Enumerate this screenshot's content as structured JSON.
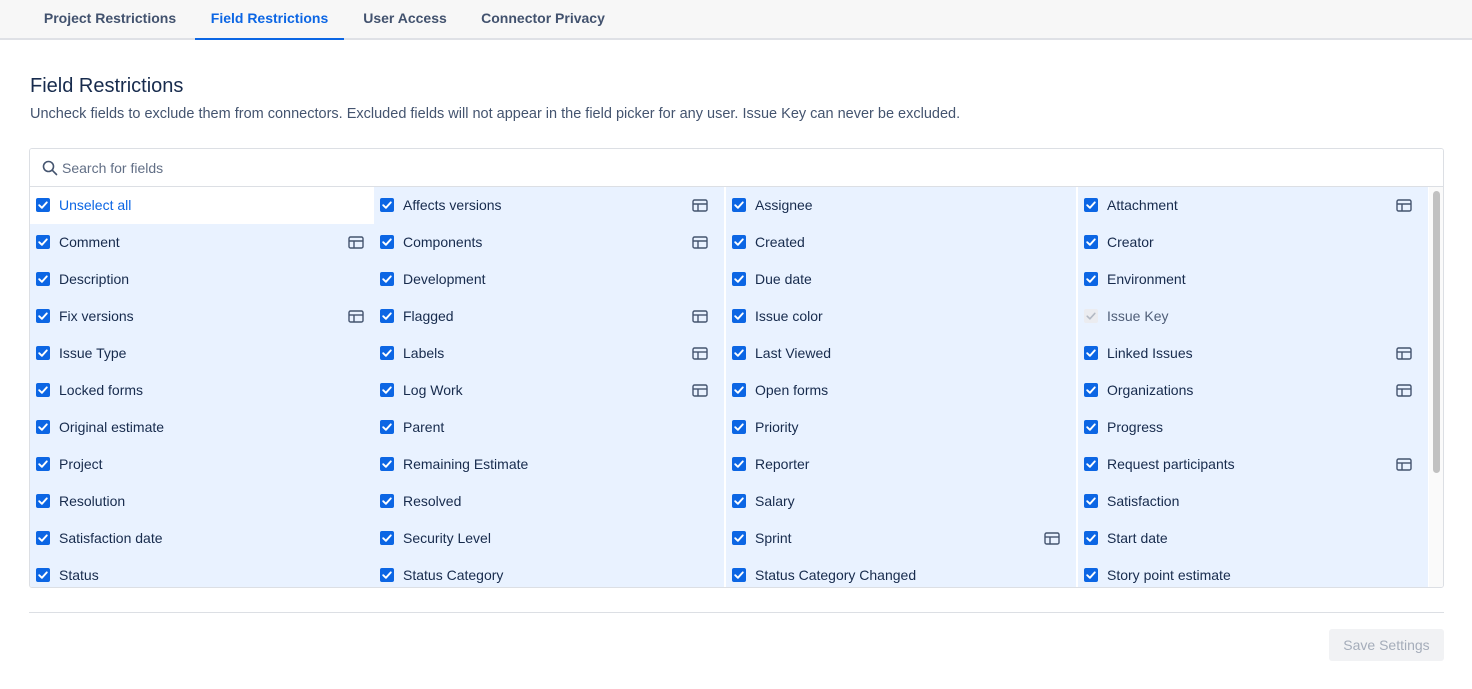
{
  "tabs": [
    {
      "label": "Project Restrictions",
      "active": false
    },
    {
      "label": "Field Restrictions",
      "active": true
    },
    {
      "label": "User Access",
      "active": false
    },
    {
      "label": "Connector Privacy",
      "active": false
    }
  ],
  "heading": "Field Restrictions",
  "description": "Uncheck fields to exclude them from connectors. Excluded fields will not appear in the field picker for any user. Issue Key can never be excluded.",
  "search": {
    "placeholder": "Search for fields",
    "value": ""
  },
  "fields": [
    {
      "label": "Unselect all",
      "checked": true,
      "kind": "toggle-all",
      "table_icon": false
    },
    {
      "label": "Affects versions",
      "checked": true,
      "table_icon": true
    },
    {
      "label": "Assignee",
      "checked": true,
      "table_icon": false
    },
    {
      "label": "Attachment",
      "checked": true,
      "table_icon": true
    },
    {
      "label": "Comment",
      "checked": true,
      "table_icon": true
    },
    {
      "label": "Components",
      "checked": true,
      "table_icon": true
    },
    {
      "label": "Created",
      "checked": true,
      "table_icon": false
    },
    {
      "label": "Creator",
      "checked": true,
      "table_icon": false
    },
    {
      "label": "Description",
      "checked": true,
      "table_icon": false
    },
    {
      "label": "Development",
      "checked": true,
      "table_icon": false
    },
    {
      "label": "Due date",
      "checked": true,
      "table_icon": false
    },
    {
      "label": "Environment",
      "checked": true,
      "table_icon": false
    },
    {
      "label": "Fix versions",
      "checked": true,
      "table_icon": true
    },
    {
      "label": "Flagged",
      "checked": true,
      "table_icon": true
    },
    {
      "label": "Issue color",
      "checked": true,
      "table_icon": false
    },
    {
      "label": "Issue Key",
      "checked": true,
      "disabled": true,
      "table_icon": false
    },
    {
      "label": "Issue Type",
      "checked": true,
      "table_icon": false
    },
    {
      "label": "Labels",
      "checked": true,
      "table_icon": true
    },
    {
      "label": "Last Viewed",
      "checked": true,
      "table_icon": false
    },
    {
      "label": "Linked Issues",
      "checked": true,
      "table_icon": true
    },
    {
      "label": "Locked forms",
      "checked": true,
      "table_icon": false
    },
    {
      "label": "Log Work",
      "checked": true,
      "table_icon": true
    },
    {
      "label": "Open forms",
      "checked": true,
      "table_icon": false
    },
    {
      "label": "Organizations",
      "checked": true,
      "table_icon": true
    },
    {
      "label": "Original estimate",
      "checked": true,
      "table_icon": false
    },
    {
      "label": "Parent",
      "checked": true,
      "table_icon": false
    },
    {
      "label": "Priority",
      "checked": true,
      "table_icon": false
    },
    {
      "label": "Progress",
      "checked": true,
      "table_icon": false
    },
    {
      "label": "Project",
      "checked": true,
      "table_icon": false
    },
    {
      "label": "Remaining Estimate",
      "checked": true,
      "table_icon": false
    },
    {
      "label": "Reporter",
      "checked": true,
      "table_icon": false
    },
    {
      "label": "Request participants",
      "checked": true,
      "table_icon": true
    },
    {
      "label": "Resolution",
      "checked": true,
      "table_icon": false
    },
    {
      "label": "Resolved",
      "checked": true,
      "table_icon": false
    },
    {
      "label": "Salary",
      "checked": true,
      "table_icon": false
    },
    {
      "label": "Satisfaction",
      "checked": true,
      "table_icon": false
    },
    {
      "label": "Satisfaction date",
      "checked": true,
      "table_icon": false
    },
    {
      "label": "Security Level",
      "checked": true,
      "table_icon": false
    },
    {
      "label": "Sprint",
      "checked": true,
      "table_icon": true
    },
    {
      "label": "Start date",
      "checked": true,
      "table_icon": false
    },
    {
      "label": "Status",
      "checked": true,
      "table_icon": false
    },
    {
      "label": "Status Category",
      "checked": true,
      "table_icon": false
    },
    {
      "label": "Status Category Changed",
      "checked": true,
      "table_icon": false
    },
    {
      "label": "Story point estimate",
      "checked": true,
      "table_icon": false
    }
  ],
  "save_button": {
    "label": "Save Settings",
    "disabled": true
  },
  "colors": {
    "accent": "#0c66e4",
    "selected_row_bg": "#e9f2ff",
    "text": "#172b4d"
  },
  "icons": {
    "search": "search-icon",
    "table": "table-icon",
    "checkbox": "checkbox-checked-icon"
  }
}
